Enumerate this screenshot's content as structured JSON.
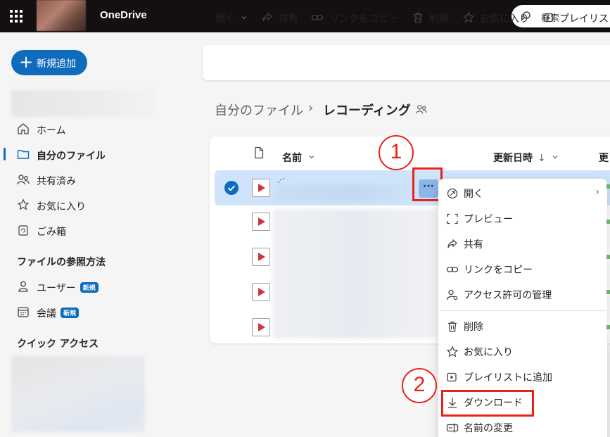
{
  "app": {
    "title": "OneDrive"
  },
  "search": {
    "placeholder": "検索"
  },
  "sidebar": {
    "new_label": "新規追加",
    "items": [
      {
        "label": "ホーム",
        "icon": "home-icon"
      },
      {
        "label": "自分のファイル",
        "icon": "folder-icon",
        "active": true
      },
      {
        "label": "共有済み",
        "icon": "people-icon"
      },
      {
        "label": "お気に入り",
        "icon": "star-icon"
      },
      {
        "label": "ごみ箱",
        "icon": "recycle-bin-icon"
      }
    ],
    "browse_heading": "ファイルの参照方法",
    "browse_items": [
      {
        "label": "ユーザー",
        "badge": "新規",
        "icon": "person-icon"
      },
      {
        "label": "会議",
        "badge": "新規",
        "icon": "calendar-icon"
      }
    ],
    "quick_access_heading": "クイック アクセス"
  },
  "toolbar": {
    "open": "開く",
    "share": "共有",
    "copy_link": "リンクをコピー",
    "delete": "削除",
    "favorite": "お気に入り",
    "playlist": "プレイリスト"
  },
  "breadcrumb": {
    "root": "自分のファイル",
    "separator": "›",
    "current": "レコーディング"
  },
  "list": {
    "col_name": "名前",
    "col_modified": "更新日時",
    "col_modified_sort": "↓",
    "col_next_partial": "更"
  },
  "more_button": "···",
  "steps": {
    "step1": "1",
    "step2": "2"
  },
  "context_menu": {
    "items": [
      {
        "label": "開く",
        "icon": "open-icon",
        "submenu": true
      },
      {
        "label": "プレビュー",
        "icon": "preview-icon"
      },
      {
        "label": "共有",
        "icon": "share-icon"
      },
      {
        "label": "リンクをコピー",
        "icon": "link-icon"
      },
      {
        "label": "アクセス許可の管理",
        "icon": "manage-access-icon"
      },
      {
        "label": "削除",
        "icon": "delete-icon"
      },
      {
        "label": "お気に入り",
        "icon": "star-icon"
      },
      {
        "label": "プレイリストに追加",
        "icon": "playlist-icon"
      },
      {
        "label": "ダウンロード",
        "icon": "download-icon"
      },
      {
        "label": "名前の変更",
        "icon": "rename-icon"
      }
    ]
  },
  "colors": {
    "accent": "#0f6cbd",
    "highlight": "#e8211b",
    "selected_row": "#cfe4fa",
    "video": "#d13438"
  }
}
